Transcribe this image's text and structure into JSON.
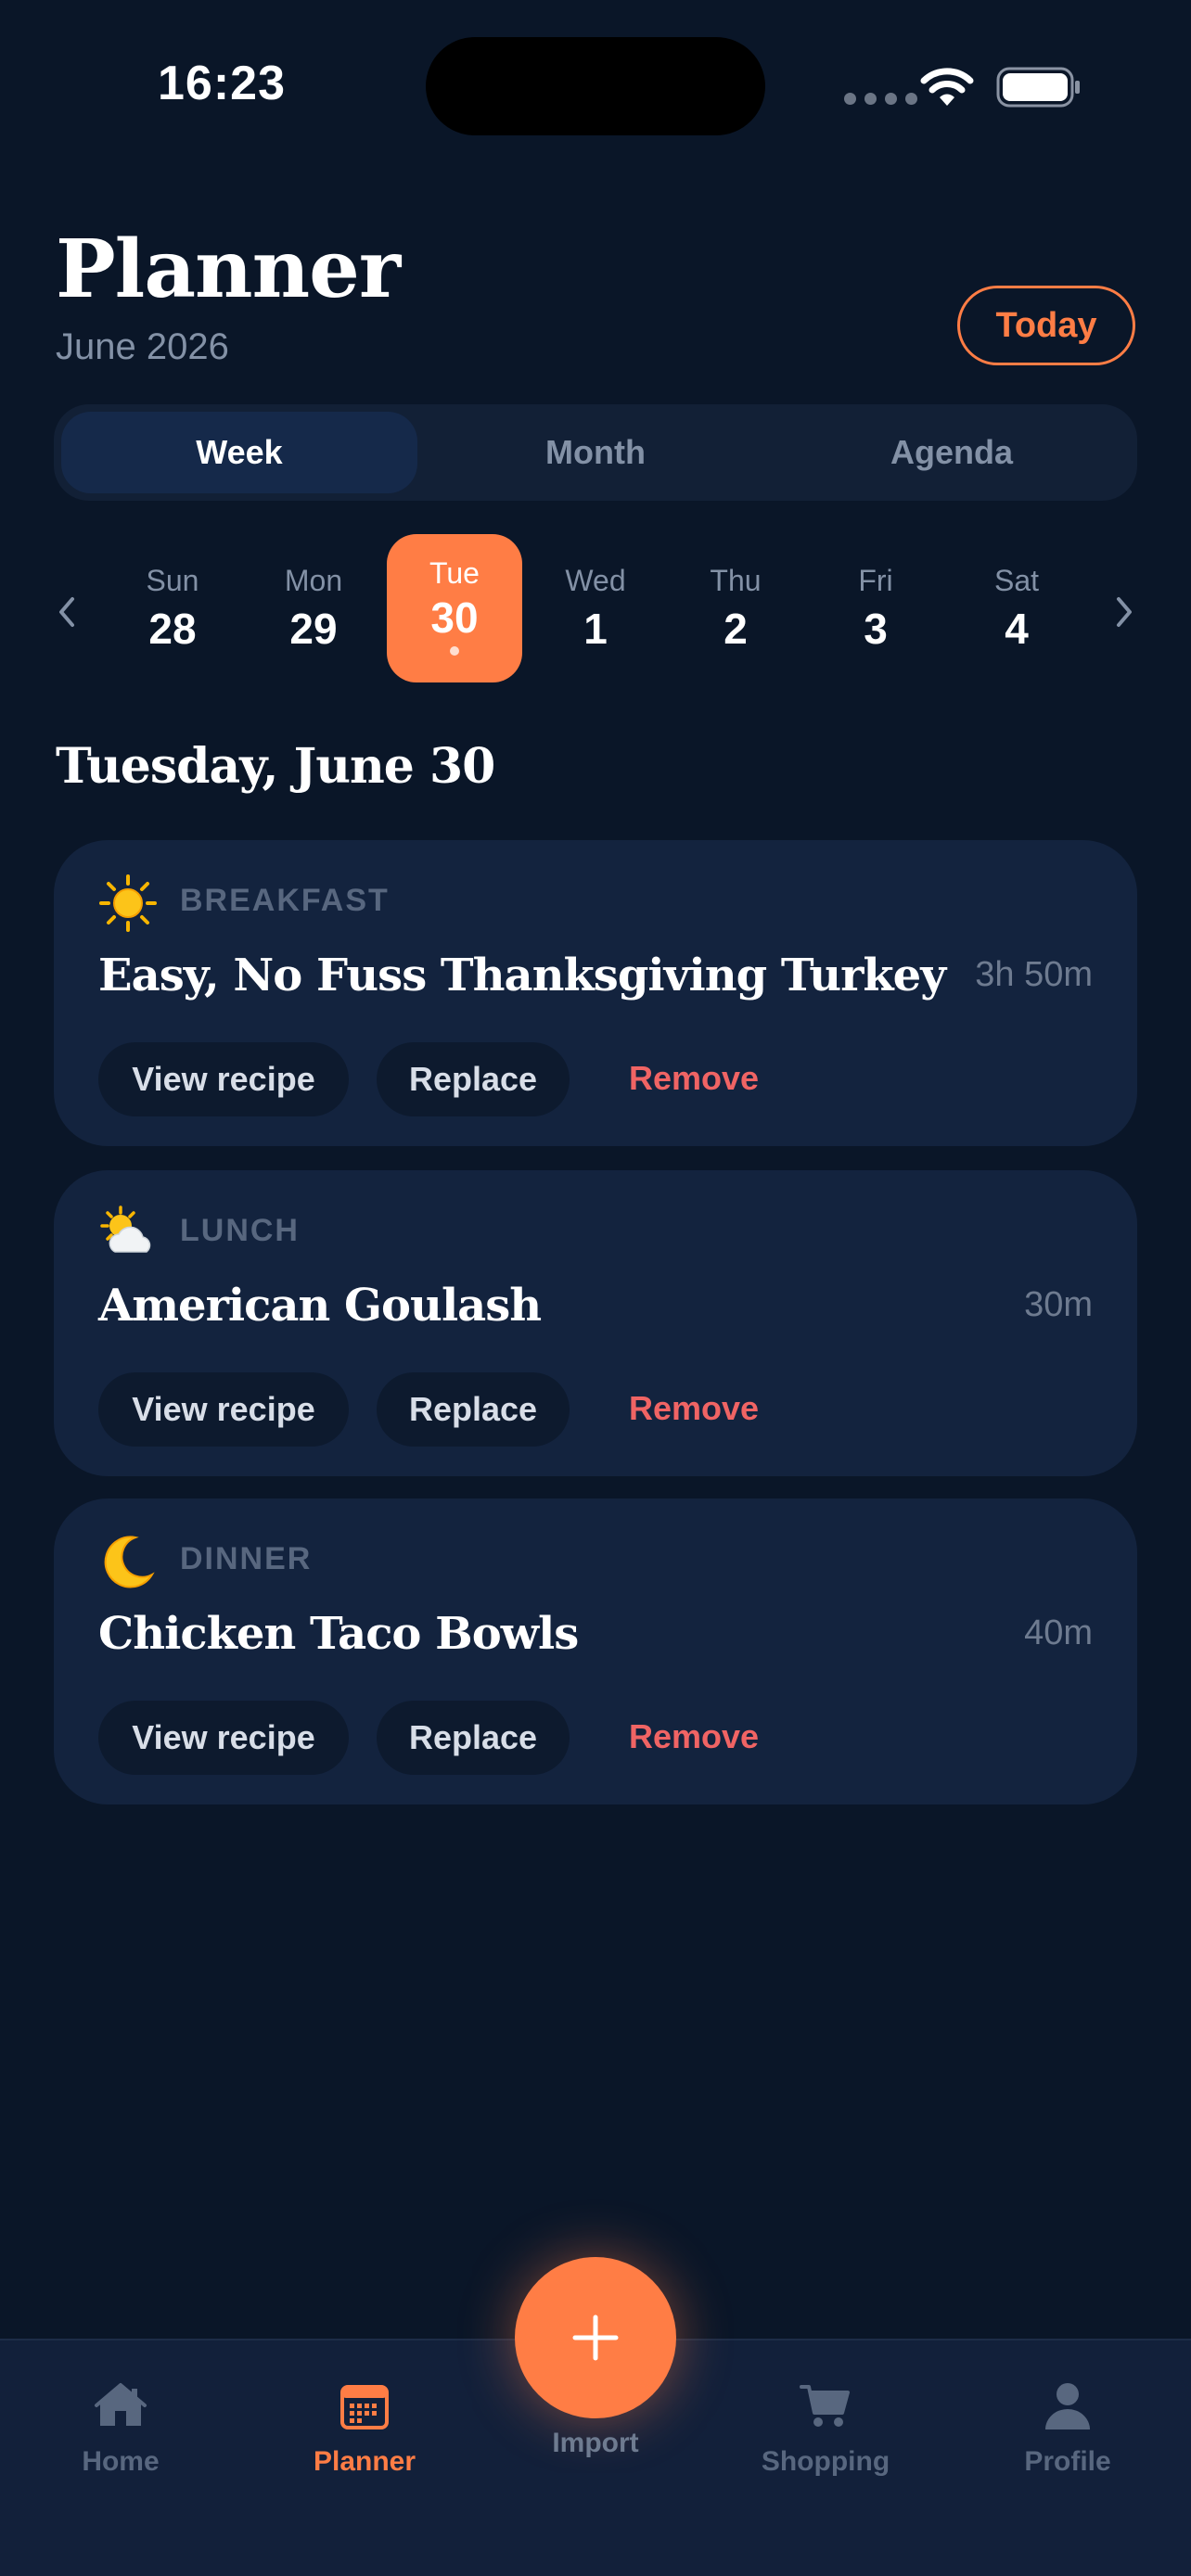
{
  "status_bar": {
    "time": "16:23"
  },
  "header": {
    "title": "Planner",
    "subtitle": "June 2026",
    "today_label": "Today"
  },
  "view_tabs": [
    {
      "label": "Week",
      "active": true
    },
    {
      "label": "Month",
      "active": false
    },
    {
      "label": "Agenda",
      "active": false
    }
  ],
  "week": {
    "days": [
      {
        "name": "Sun",
        "num": "28"
      },
      {
        "name": "Mon",
        "num": "29"
      },
      {
        "name": "Tue",
        "num": "30",
        "selected": true
      },
      {
        "name": "Wed",
        "num": "1"
      },
      {
        "name": "Thu",
        "num": "2"
      },
      {
        "name": "Fri",
        "num": "3"
      },
      {
        "name": "Sat",
        "num": "4"
      }
    ]
  },
  "selected_date_heading": "Tuesday, June 30",
  "meals": [
    {
      "slot": "BREAKFAST",
      "icon": "sun-icon",
      "recipe": "Easy, No Fuss Thanksgiving Turkey",
      "duration": "3h 50m",
      "view_label": "View recipe",
      "replace_label": "Replace",
      "remove_label": "Remove"
    },
    {
      "slot": "LUNCH",
      "icon": "sun-behind-cloud-icon",
      "recipe": "American Goulash",
      "duration": "30m",
      "view_label": "View recipe",
      "replace_label": "Replace",
      "remove_label": "Remove"
    },
    {
      "slot": "DINNER",
      "icon": "crescent-moon-icon",
      "recipe": "Chicken Taco Bowls",
      "duration": "40m",
      "view_label": "View recipe",
      "replace_label": "Replace",
      "remove_label": "Remove"
    }
  ],
  "tab_bar": {
    "items": [
      {
        "label": "Home",
        "icon": "home-icon"
      },
      {
        "label": "Planner",
        "icon": "calendar-icon",
        "active": true
      },
      {
        "label": "Import",
        "icon": "plus-icon"
      },
      {
        "label": "Shopping",
        "icon": "cart-icon"
      },
      {
        "label": "Profile",
        "icon": "person-icon"
      }
    ]
  },
  "colors": {
    "background": "#0a1628",
    "card": "#13233e",
    "accent": "#ff7d45",
    "danger": "#f06464",
    "muted": "#8391a6"
  }
}
